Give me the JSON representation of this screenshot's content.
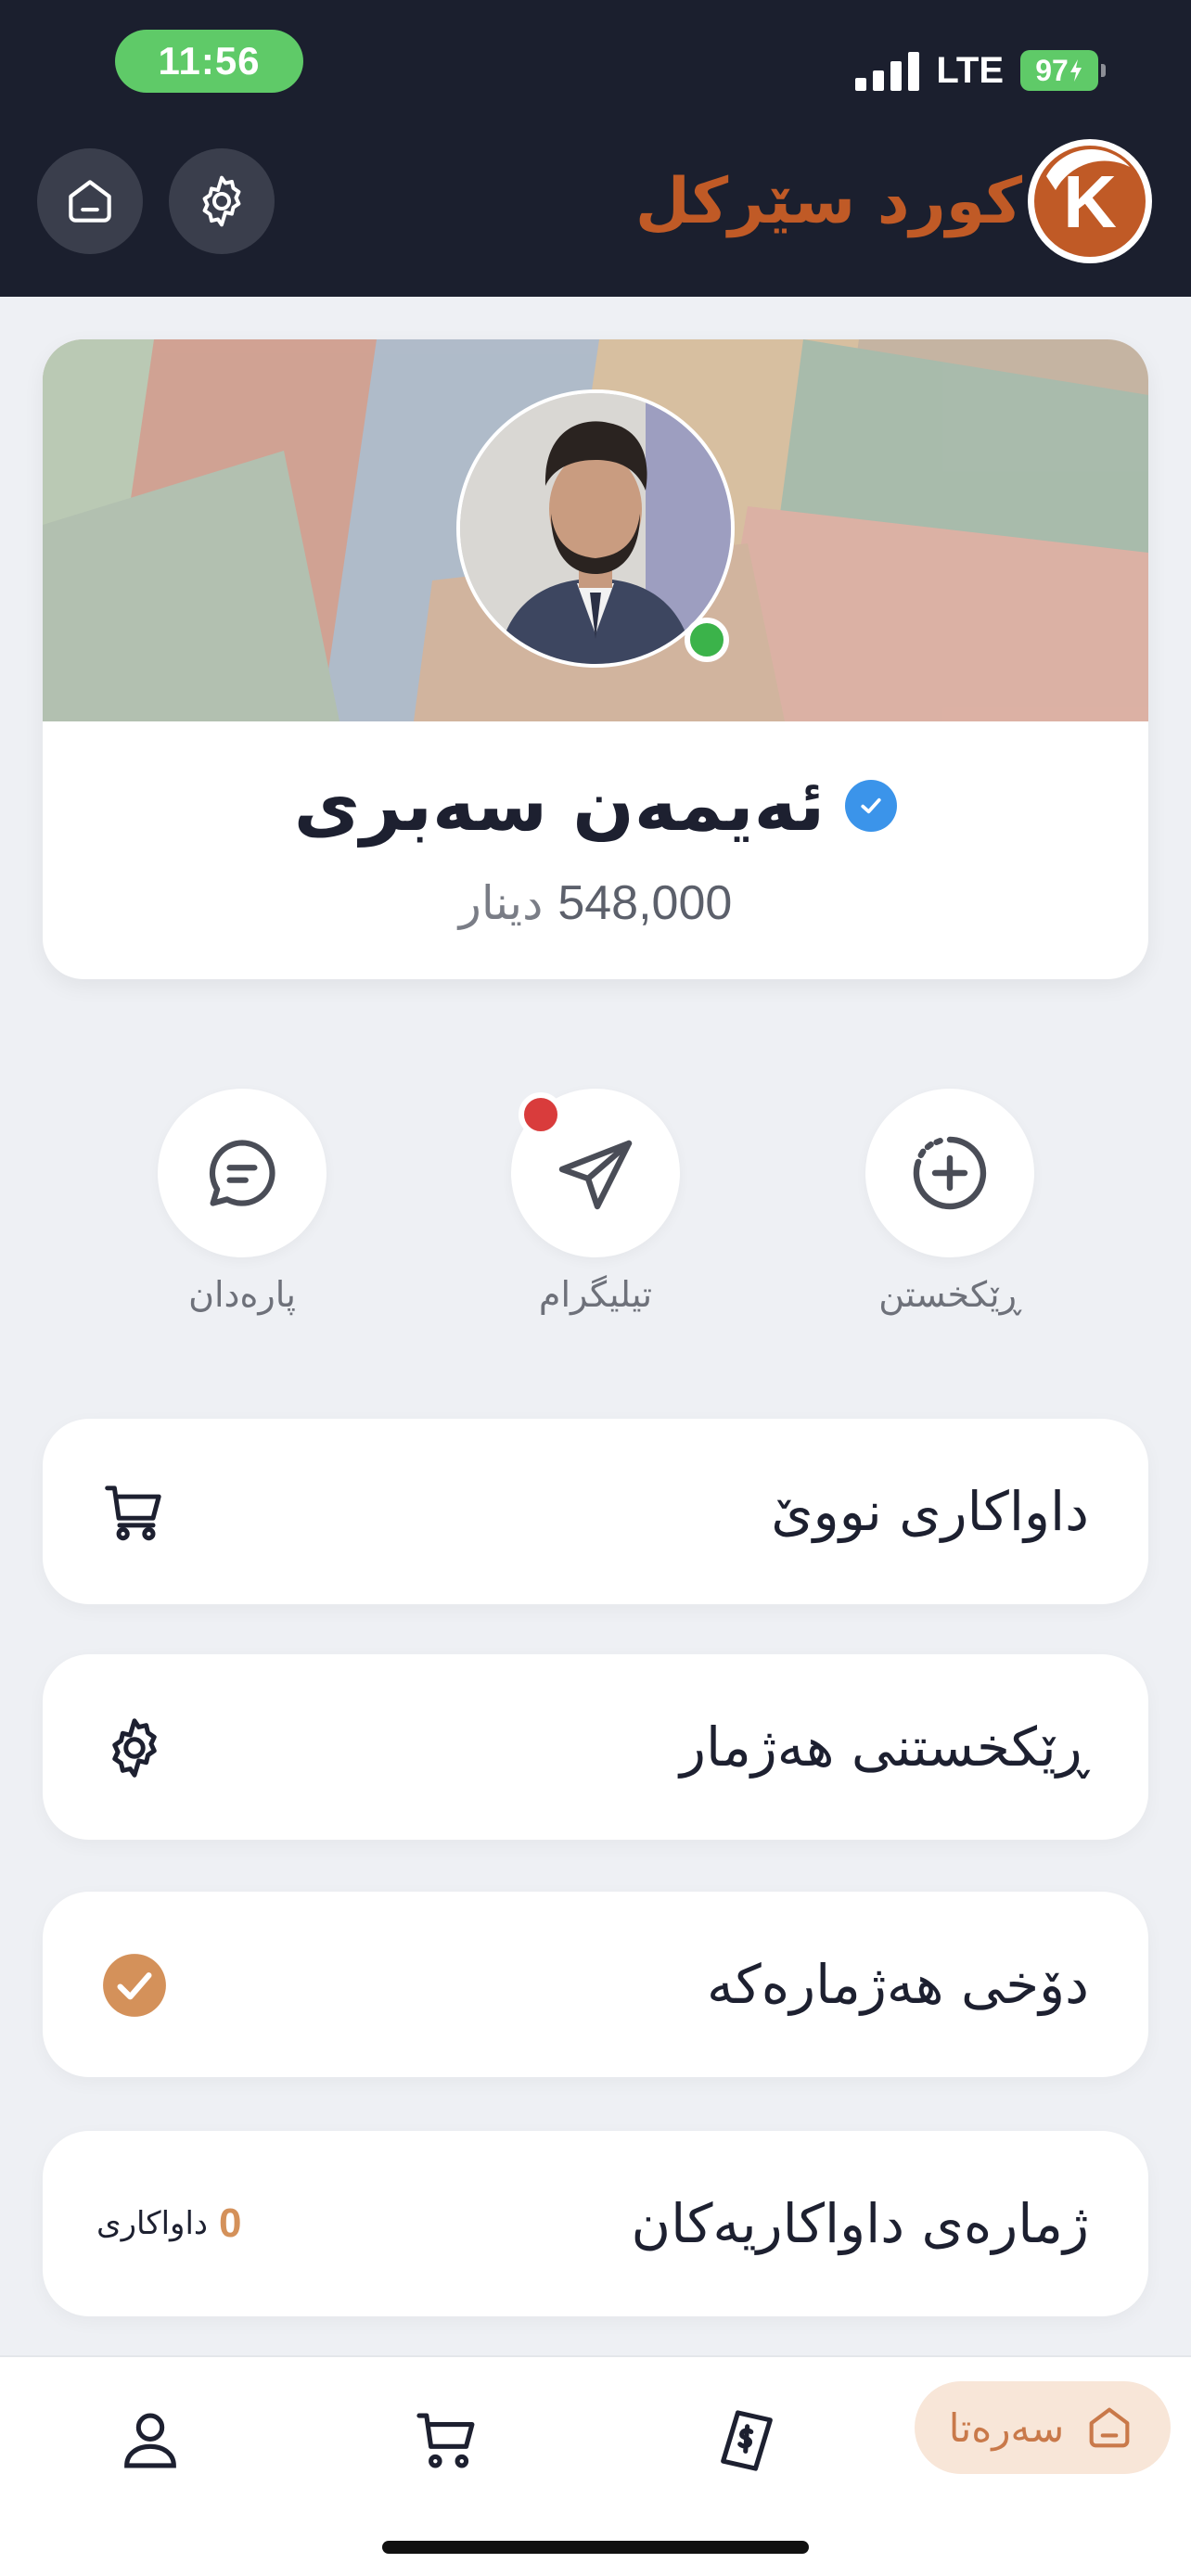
{
  "status_bar": {
    "time": "11:56",
    "network": "LTE",
    "battery": "97"
  },
  "header": {
    "brand_name": "کورد سێرکل",
    "logo_letter": "K",
    "home_icon": "home-icon",
    "settings_icon": "gear-icon"
  },
  "profile": {
    "name": "ئەیمەن سەبری",
    "balance_amount": "548,000",
    "currency": "دینار",
    "verified": true,
    "online": true
  },
  "quick_actions": [
    {
      "label": "پارەدان",
      "icon": "chat-bubble-icon"
    },
    {
      "label": "تیلیگرام",
      "icon": "telegram-icon",
      "has_notification": true
    },
    {
      "label": "ڕێکخستن",
      "icon": "plus-circle-icon"
    }
  ],
  "menu": {
    "new_order": {
      "label": "داواکاری نووێ",
      "icon": "cart-icon"
    },
    "account_settings": {
      "label": "ڕێکخستنی هەژمار",
      "icon": "gear-icon"
    },
    "account_status": {
      "label": "دۆخی هەژمارەکە",
      "icon": "check-circle-icon"
    },
    "orders_count": {
      "label": "ژمارەی داواکاریەکان",
      "count": "0",
      "unit": "داواکاری"
    }
  },
  "bottom_nav": {
    "home_label": "سەرەتا",
    "items": [
      "profile-icon",
      "cart-icon",
      "price-tag-icon",
      "home-icon"
    ]
  },
  "colors": {
    "header_bg": "#1b1f2e",
    "brand": "#c05a26",
    "accent": "#d4915a",
    "status_green": "#5fca68",
    "verified_blue": "#3b94ea",
    "online_green": "#3bb34a",
    "notification_red": "#d93c3c"
  }
}
